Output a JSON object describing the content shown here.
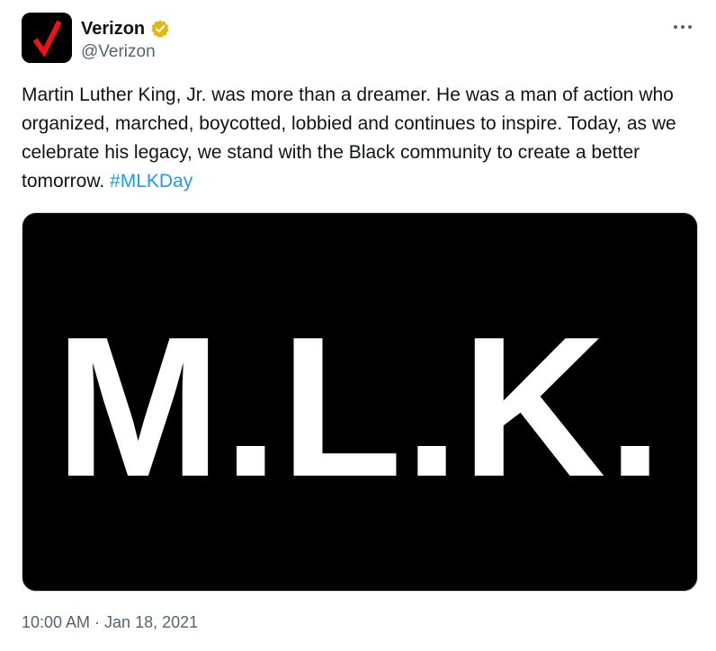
{
  "author": {
    "display_name": "Verizon",
    "handle": "@Verizon",
    "avatar_icon": "verizon-checkmark-logo",
    "verified_icon": "verified-gold-badge-icon",
    "verified_color": "#e2b719"
  },
  "menu": {
    "icon": "more-horizontal-icon"
  },
  "tweet": {
    "text": "Martin Luther King, Jr. was more than a dreamer. He was a man of action who organized, marched, boycotted, lobbied and continues to inspire. Today, as we celebrate his legacy, we stand with the Black community to create a better tomorrow. ",
    "hashtag": "#MLKDay",
    "hashtag_color": "#1d9bf0"
  },
  "media": {
    "image_text": "M.L.K.",
    "background_color": "#000000"
  },
  "meta": {
    "timestamp": "10:00 AM · Jan 18, 2021"
  }
}
